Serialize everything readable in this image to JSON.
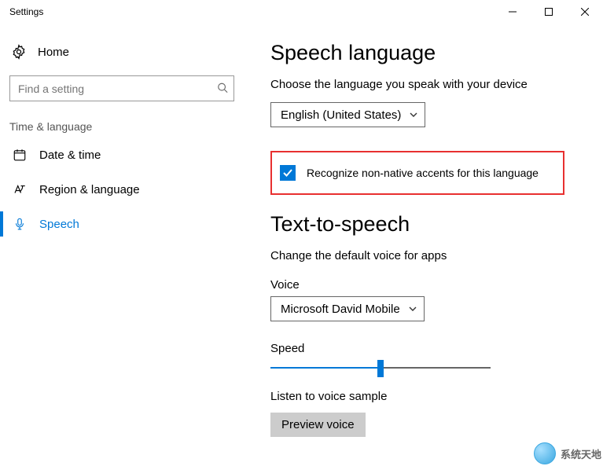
{
  "window": {
    "title": "Settings"
  },
  "sidebar": {
    "home": "Home",
    "search_placeholder": "Find a setting",
    "category": "Time & language",
    "items": [
      {
        "label": "Date & time"
      },
      {
        "label": "Region & language"
      },
      {
        "label": "Speech"
      }
    ]
  },
  "content": {
    "speech_heading": "Speech language",
    "speech_desc": "Choose the language you speak with your device",
    "speech_select": "English (United States)",
    "accent_checkbox": "Recognize non-native accents for this language",
    "tts_heading": "Text-to-speech",
    "tts_desc": "Change the default voice for apps",
    "voice_label": "Voice",
    "voice_select": "Microsoft David Mobile",
    "speed_label": "Speed",
    "speed_value_percent": 50,
    "listen_label": "Listen to voice sample",
    "preview_button": "Preview voice"
  },
  "watermark": "系统天地"
}
